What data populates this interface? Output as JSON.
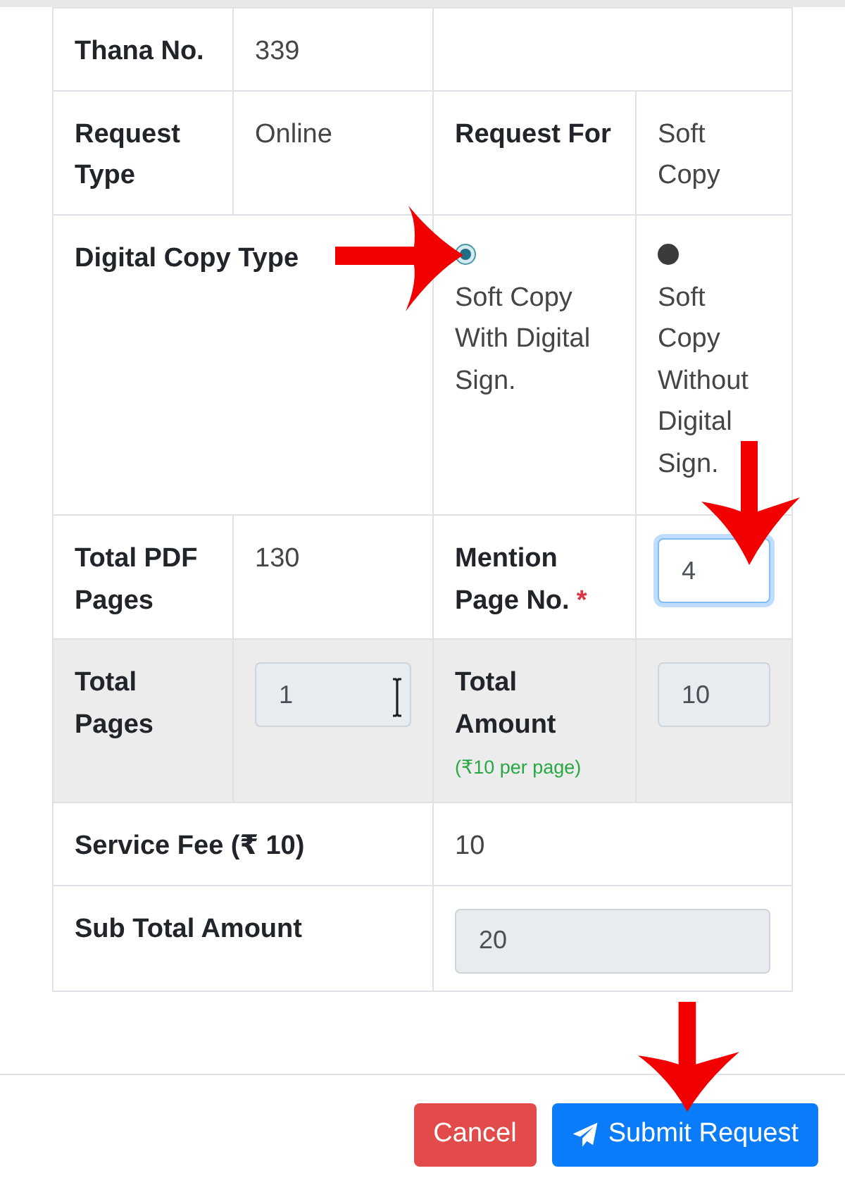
{
  "table": {
    "rows": [
      {
        "shaded": false,
        "cells": [
          {
            "kind": "label",
            "text": "Thana No."
          },
          {
            "kind": "value",
            "text": "339"
          },
          {
            "kind": "blank",
            "colspan": 2
          }
        ]
      },
      {
        "shaded": false,
        "cells": [
          {
            "kind": "label",
            "text": "Request Type"
          },
          {
            "kind": "value",
            "text": "Online"
          },
          {
            "kind": "label",
            "text": "Request For"
          },
          {
            "kind": "value",
            "text": "Soft Copy"
          }
        ]
      },
      {
        "shaded": false,
        "cells": [
          {
            "kind": "label",
            "text": "Digital Copy Type",
            "colspan": 2
          },
          {
            "kind": "radio",
            "text": "Soft Copy With Digital Sign.",
            "selected": true,
            "callout": true
          },
          {
            "kind": "radio",
            "text": "Soft Copy Without Digital Sign.",
            "selected": false
          }
        ]
      },
      {
        "shaded": false,
        "cells": [
          {
            "kind": "label",
            "text": "Total PDF Pages"
          },
          {
            "kind": "value",
            "text": "130"
          },
          {
            "kind": "label",
            "text": "Mention Page No.",
            "required_mark": "*"
          },
          {
            "kind": "input",
            "value": "4",
            "readonly": false,
            "focused": true,
            "callout": true
          }
        ]
      },
      {
        "shaded": true,
        "cells": [
          {
            "kind": "label",
            "text": "Total Pages"
          },
          {
            "kind": "input",
            "value": "1",
            "readonly": true,
            "focused": false,
            "text_cursor": true
          },
          {
            "kind": "label",
            "text": "Total Amount",
            "note": "(₹10 per page)"
          },
          {
            "kind": "input",
            "value": "10",
            "readonly": true,
            "focused": false
          }
        ]
      },
      {
        "shaded": false,
        "cells": [
          {
            "kind": "label",
            "text": "Service Fee (₹ 10)",
            "colspan": 2
          },
          {
            "kind": "value",
            "text": "10",
            "colspan": 2
          }
        ]
      },
      {
        "shaded": false,
        "cells": [
          {
            "kind": "label",
            "text": "Sub Total Amount",
            "colspan": 2
          },
          {
            "kind": "input",
            "value": "20",
            "readonly": true,
            "focused": false,
            "colspan": 2
          }
        ]
      }
    ]
  },
  "footer": {
    "buttons": [
      {
        "kind": "cancel",
        "label": "Cancel"
      },
      {
        "kind": "submit",
        "label": "Submit Request",
        "callout": true
      }
    ]
  }
}
